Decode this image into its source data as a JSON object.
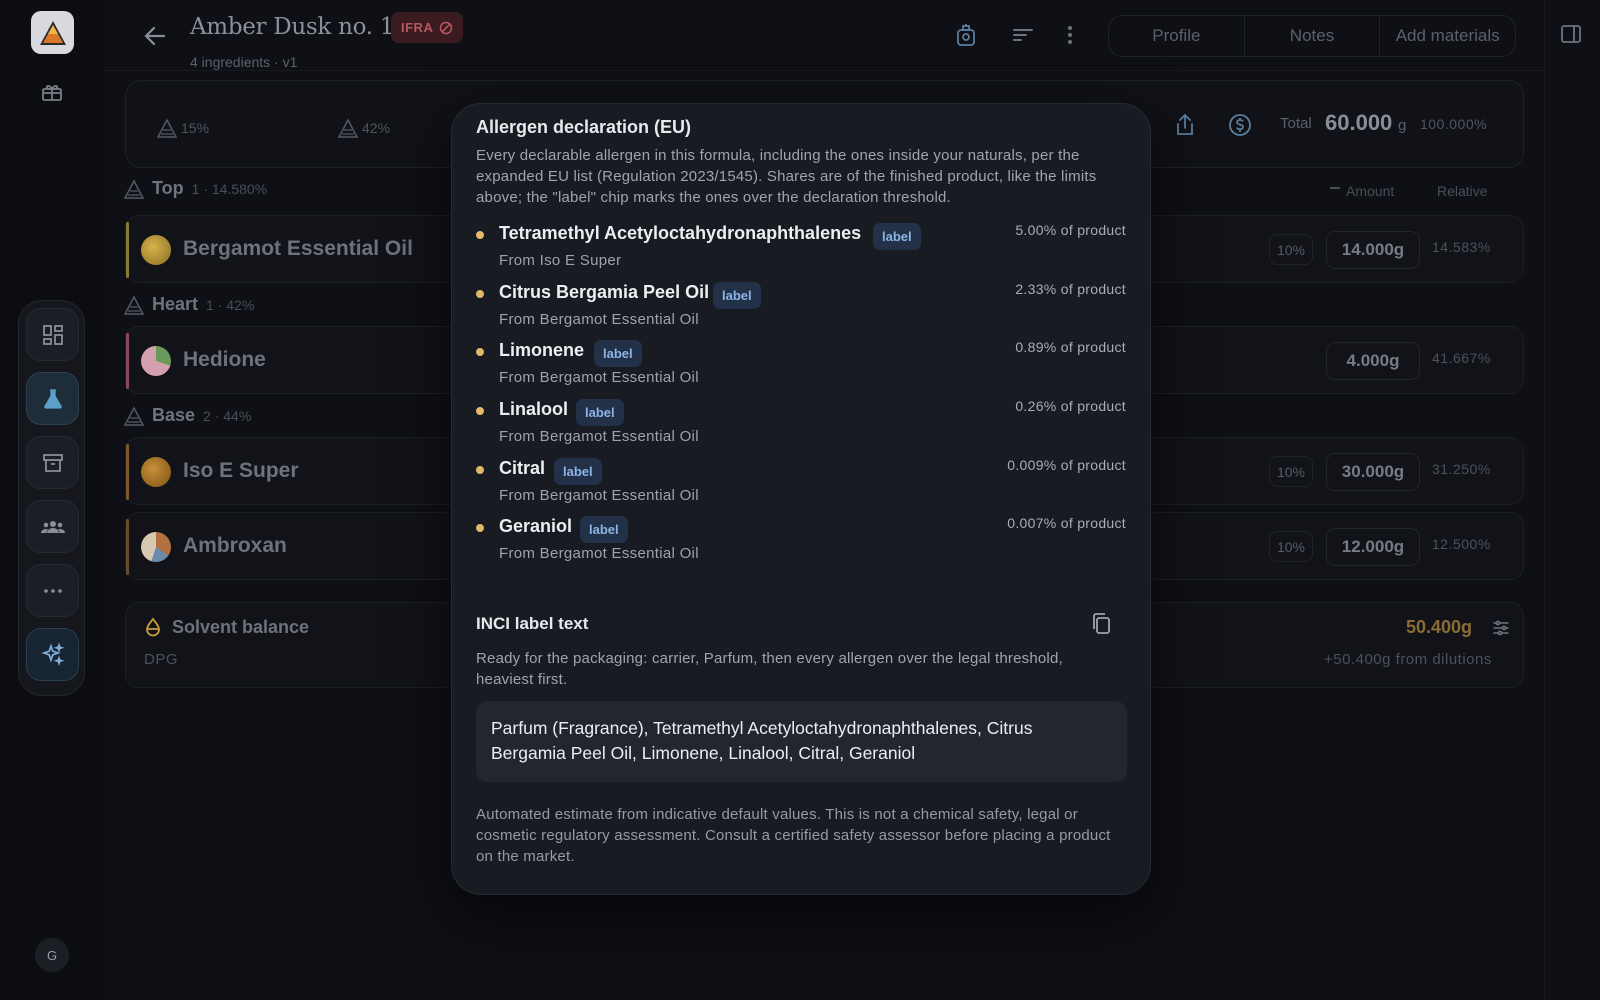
{
  "header": {
    "title": "Amber Dusk no. 1",
    "ifra_badge": "IFRA",
    "subtitle": "4 ingredients · v1",
    "tabs": [
      "Profile",
      "Notes",
      "Add materials"
    ]
  },
  "summary": {
    "pyramid": [
      {
        "label": "15%"
      },
      {
        "label": "42%"
      }
    ],
    "total_label": "Total",
    "total_value": "60.000",
    "total_unit": "g",
    "total_pct": "100.000%"
  },
  "columns": {
    "amount": "Amount",
    "relative": "Relative"
  },
  "sections": [
    {
      "name": "Top",
      "meta": "1 · 14.580%"
    },
    {
      "name": "Heart",
      "meta": "1 · 42%"
    },
    {
      "name": "Base",
      "meta": "2 · 44%"
    }
  ],
  "ingredients": [
    {
      "name": "Bergamot Essential Oil",
      "dilution": "10%",
      "amount": "14.000g",
      "relative": "14.583%",
      "accent": "#8a7a2e",
      "dot": "#c9a23b"
    },
    {
      "name": "Hedione",
      "dilution": "",
      "amount": "4.000g",
      "relative": "41.667%",
      "accent": "#8a4a5a",
      "dot": "#c98aa0"
    },
    {
      "name": "Iso E Super",
      "dilution": "10%",
      "amount": "30.000g",
      "relative": "31.250%",
      "accent": "#7a5a2e",
      "dot": "#b8822f"
    },
    {
      "name": "Ambroxan",
      "dilution": "10%",
      "amount": "12.000g",
      "relative": "12.500%",
      "accent": "#6a4a2e",
      "dot": "#a36a3a"
    }
  ],
  "solvent": {
    "title": "Solvent balance",
    "name": "DPG",
    "amount": "50.400g",
    "note": "+50.400g from dilutions"
  },
  "modal": {
    "title": "Allergen declaration (EU)",
    "description": "Every declarable allergen in this formula, including the ones inside your naturals, per the expanded EU list (Regulation 2023/1545). Shares are of the finished product, like the limits above; the \"label\" chip marks the ones over the declaration threshold.",
    "allergens": [
      {
        "name": "Tetramethyl Acetyloctahydronaphthalenes",
        "chip": "label",
        "source": "From Iso E Super",
        "share": "5.00% of product"
      },
      {
        "name": "Citrus Bergamia Peel Oil",
        "chip": "label",
        "source": "From Bergamot Essential Oil",
        "share": "2.33% of product"
      },
      {
        "name": "Limonene",
        "chip": "label",
        "source": "From Bergamot Essential Oil",
        "share": "0.89% of product"
      },
      {
        "name": "Linalool",
        "chip": "label",
        "source": "From Bergamot Essential Oil",
        "share": "0.26% of product"
      },
      {
        "name": "Citral",
        "chip": "label",
        "source": "From Bergamot Essential Oil",
        "share": "0.009% of product"
      },
      {
        "name": "Geraniol",
        "chip": "label",
        "source": "From Bergamot Essential Oil",
        "share": "0.007% of product"
      }
    ],
    "inci_title": "INCI label text",
    "inci_description": "Ready for the packaging: carrier, Parfum, then every allergen over the legal threshold, heaviest first.",
    "inci_text": "Parfum (Fragrance), Tetramethyl Acetyloctahydronaphthalenes, Citrus Bergamia Peel Oil, Limonene, Linalool, Citral, Geraniol",
    "disclaimer": "Automated estimate from indicative default values. This is not a chemical safety, legal or cosmetic regulatory assessment. Consult a certified safety assessor before placing a product on the market."
  },
  "user": {
    "initial": "G"
  },
  "colors": {
    "allergen_dot": "#e3b96a",
    "chip_bg": "#223048",
    "chip_text": "#8db4e6",
    "ifra_text": "#b5565d"
  }
}
